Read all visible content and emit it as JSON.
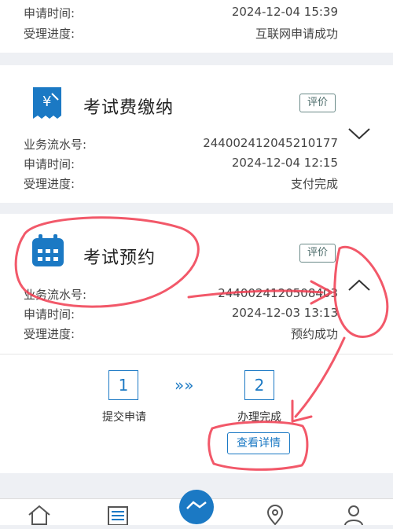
{
  "card1": {
    "rows": [
      {
        "key": "申请时间:",
        "value": "2024-12-04 15:39"
      },
      {
        "key": "受理进度:",
        "value": "互联网申请成功"
      }
    ]
  },
  "card2": {
    "title": "考试费缴纳",
    "rate_label": "评价",
    "rows": [
      {
        "key": "业务流水号:",
        "value": "244002412045210177"
      },
      {
        "key": "申请时间:",
        "value": "2024-12-04 12:15"
      },
      {
        "key": "受理进度:",
        "value": "支付完成"
      }
    ]
  },
  "card3": {
    "title": "考试预约",
    "rate_label": "评价",
    "rows": [
      {
        "key": "业务流水号:",
        "value": "2440024120508403"
      },
      {
        "key": "申请时间:",
        "value": "2024-12-03 13:13"
      },
      {
        "key": "受理进度:",
        "value": "预约成功"
      }
    ],
    "steps": [
      {
        "number": "1",
        "label": "提交申请"
      },
      {
        "number": "2",
        "label": "办理完成"
      }
    ],
    "step_arrow": "»»",
    "detail_label": "查看详情"
  },
  "colors": {
    "accent": "#1b79c4",
    "annotation": "#f03c50",
    "background": "#eef0f4"
  },
  "tabbar": {
    "icons": [
      "home-icon",
      "list-icon",
      "handshake-icon",
      "map-pin-icon",
      "user-icon"
    ]
  }
}
